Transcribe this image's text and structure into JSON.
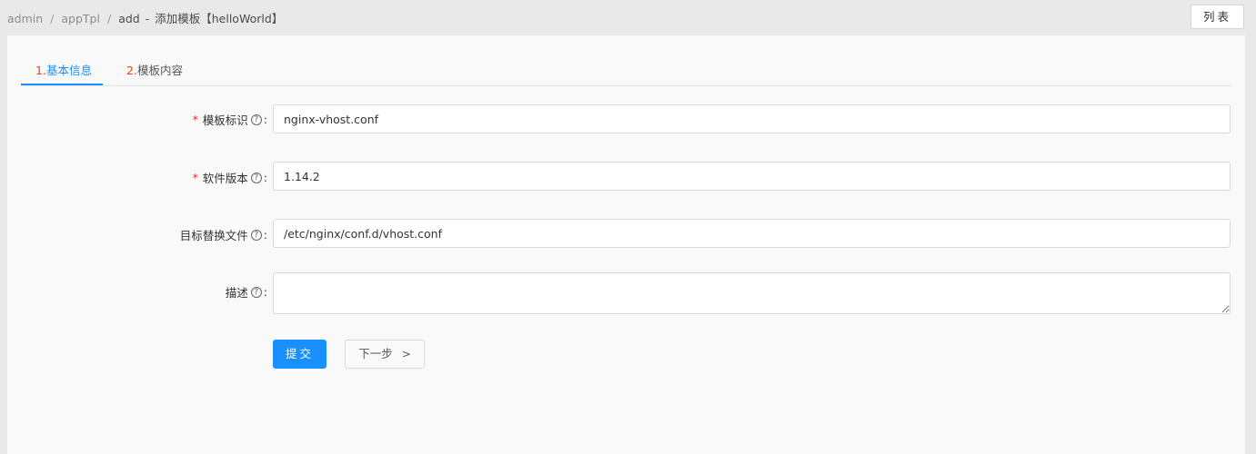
{
  "breadcrumb": {
    "items": [
      "admin",
      "appTpl",
      "add"
    ],
    "separator": "/",
    "title": "添加模板【helloWorld】",
    "title_separator": "-"
  },
  "header": {
    "list_button": "列表"
  },
  "tabs": [
    {
      "num": "1.",
      "label": "基本信息",
      "active": true
    },
    {
      "num": "2.",
      "label": "模板内容",
      "active": false
    }
  ],
  "form": {
    "fields": [
      {
        "label": "模板标识",
        "required": true,
        "value": "nginx-vhost.conf"
      },
      {
        "label": "软件版本",
        "required": true,
        "value": "1.14.2"
      },
      {
        "label": "目标替换文件",
        "required": false,
        "value": "/etc/nginx/conf.d/vhost.conf"
      },
      {
        "label": "描述",
        "required": false,
        "value": ""
      }
    ],
    "required_mark": "*",
    "help_icon": "?",
    "colon": ":",
    "submit_label": "提交",
    "next_label": "下一步",
    "next_icon": ">"
  },
  "colors": {
    "primary": "#1890ff",
    "required": "#f5222d",
    "tab_number": "#e0451e"
  }
}
